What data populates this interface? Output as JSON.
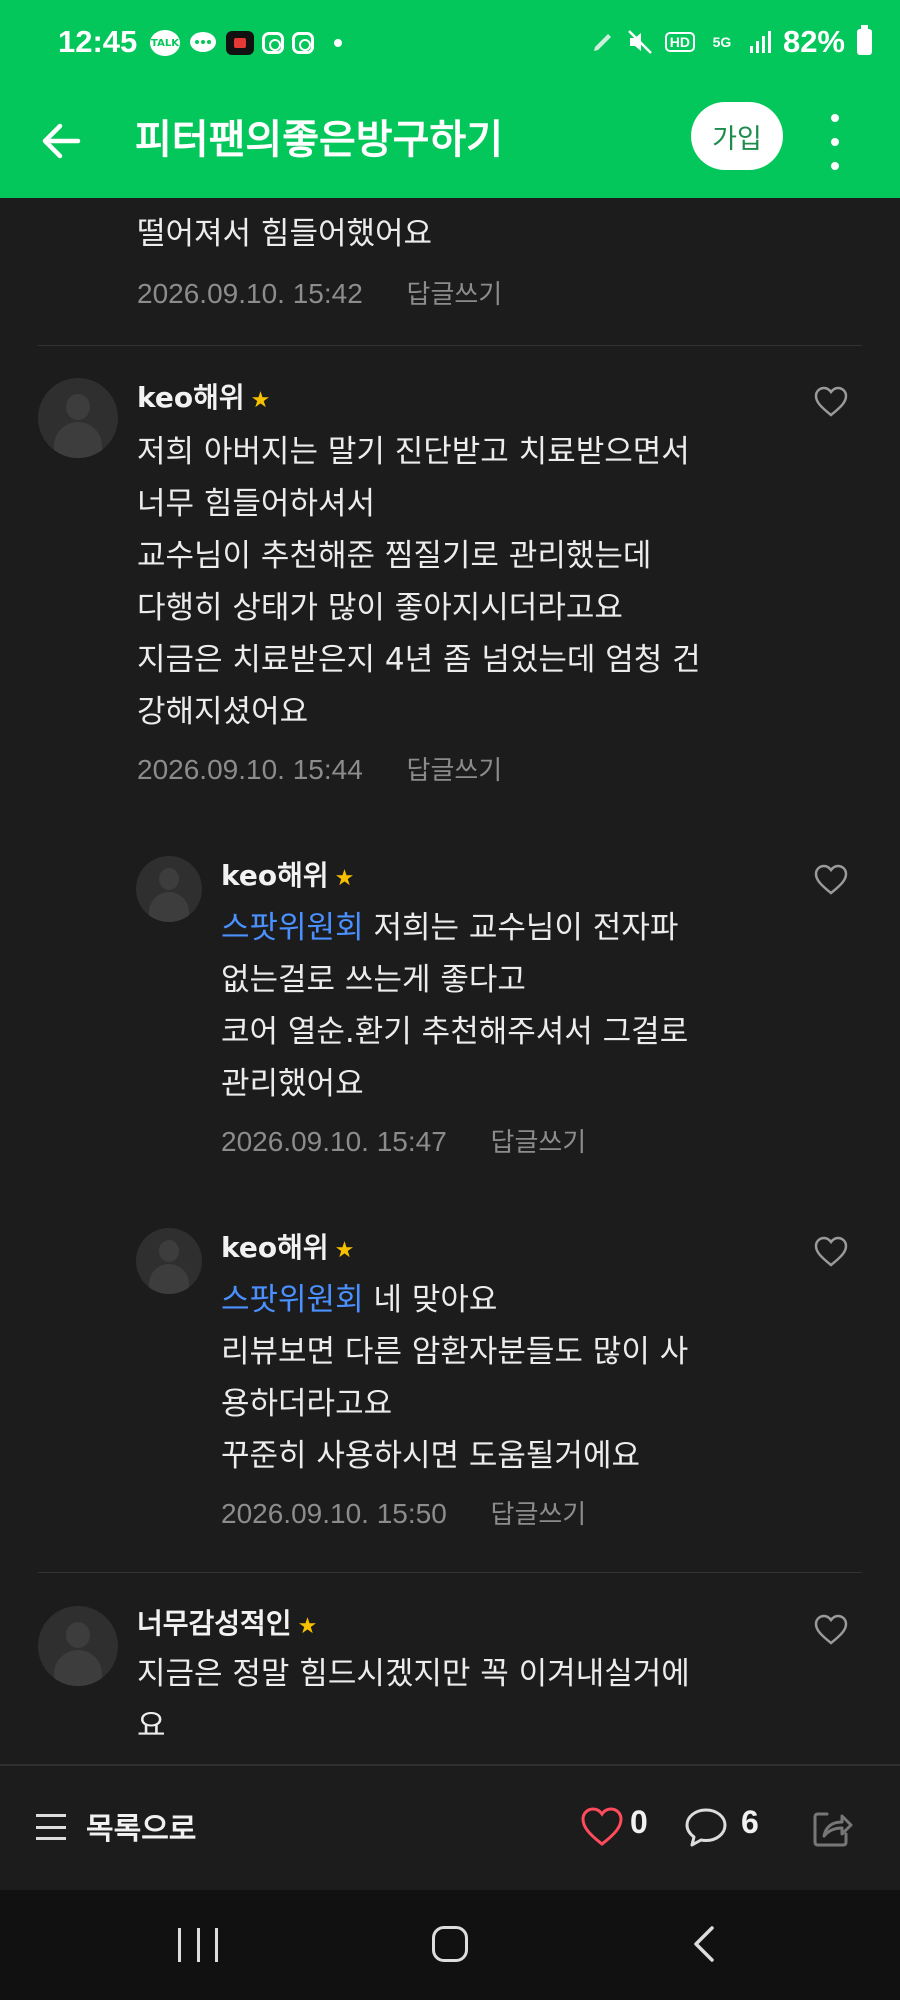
{
  "status_bar": {
    "time": "12:45",
    "talk_label": "TALK",
    "network": "5G",
    "hd": "HD",
    "battery": "82%"
  },
  "app_bar": {
    "title": "피터팬의좋은방구하기",
    "join_label": "가입"
  },
  "top_partial": {
    "text": "떨어져서 힘들어했어요",
    "timestamp": "2026.09.10. 15:42",
    "reply_label": "답글쓰기"
  },
  "comments": [
    {
      "nickname": "keo해위",
      "lines": [
        "저희 아버지는 말기 진단받고 치료받으면서",
        "너무 힘들어하셔서",
        "교수님이 추천해준 찜질기로 관리했는데",
        "다행히 상태가 많이 좋아지시더라고요",
        "지금은 치료받은지 4년 좀 넘었는데 엄청 건",
        "강해지셨어요"
      ],
      "timestamp": "2026.09.10. 15:44",
      "reply_label": "답글쓰기"
    },
    {
      "nickname": "keo해위",
      "mention": "스팟위원회",
      "first_line": " 저희는 교수님이 전자파",
      "lines": [
        "없는걸로 쓰는게 좋다고",
        "코어 열순.환기 추천해주셔서 그걸로",
        "관리했어요"
      ],
      "timestamp": "2026.09.10. 15:47",
      "reply_label": "답글쓰기"
    },
    {
      "nickname": "keo해위",
      "mention": "스팟위원회",
      "first_line": " 네 맞아요",
      "lines": [
        "리뷰보면 다른 암환자분들도 많이 사",
        "용하더라고요",
        "꾸준히 사용하시면 도움될거에요"
      ],
      "timestamp": "2026.09.10. 15:50",
      "reply_label": "답글쓰기"
    },
    {
      "nickname": "너무감성적인",
      "lines": [
        "지금은 정말 힘드시겠지만 꼭 이겨내실거에",
        "요"
      ]
    }
  ],
  "bottom_bar": {
    "list_label": "목록으로",
    "like_count": "0",
    "comment_count": "6"
  },
  "icons": {
    "back": "arrow-left-icon",
    "more": "more-vertical-icon",
    "heart": "heart-icon",
    "comment": "comment-icon",
    "share": "share-icon",
    "menu": "menu-icon"
  },
  "colors": {
    "brand": "#03c75a",
    "mention": "#4a90ff",
    "like": "#ff4b5c",
    "background": "#1c1c1c"
  }
}
